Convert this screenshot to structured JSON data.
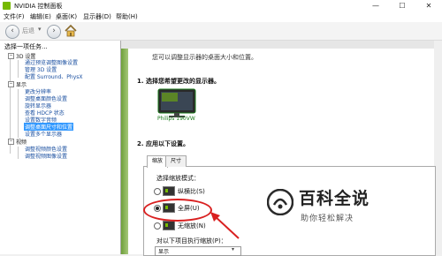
{
  "window": {
    "title": "NVIDIA 控制面板",
    "minimize": "—",
    "maximize": "☐",
    "close": "✕"
  },
  "menubar": {
    "items": [
      "文件(F)",
      "编辑(E)",
      "桌面(K)",
      "显示器(D)",
      "帮助(H)"
    ]
  },
  "toolbar": {
    "back_label": "后退",
    "back_icon": "arrow-left-icon",
    "forward_icon": "arrow-right-icon",
    "home_icon": "home-icon"
  },
  "left_pane": {
    "header": "选择一项任务...",
    "tree": [
      {
        "label": "3D 设置",
        "type": "category"
      },
      {
        "label": "通过预览调整图像设置",
        "type": "link"
      },
      {
        "label": "管理 3D 设置",
        "type": "link"
      },
      {
        "label": "配置 Surround、PhysX",
        "type": "link"
      },
      {
        "label": "显示",
        "type": "category"
      },
      {
        "label": "更改分辨率",
        "type": "link"
      },
      {
        "label": "调整桌面颜色设置",
        "type": "link"
      },
      {
        "label": "旋转显示器",
        "type": "link"
      },
      {
        "label": "查看 HDCP 状态",
        "type": "link"
      },
      {
        "label": "设置数字音频",
        "type": "link"
      },
      {
        "label": "调整桌面尺寸和位置",
        "type": "selected"
      },
      {
        "label": "设置多个显示器",
        "type": "link"
      },
      {
        "label": "视频",
        "type": "category"
      },
      {
        "label": "调整视频颜色设置",
        "type": "link"
      },
      {
        "label": "调整视频图像设置",
        "type": "link"
      }
    ]
  },
  "main": {
    "intro": "您可以调整显示器的桌面大小和位置。",
    "section1_title": "1. 选择您希望更改的显示器。",
    "monitor_label": "Philips 190VW",
    "section2_title": "2. 应用以下设置。",
    "tabs": [
      "缩放",
      "尺寸"
    ],
    "scaling_mode_label": "选择缩放模式：",
    "options": [
      {
        "label": "纵横比(S)",
        "selected": false
      },
      {
        "label": "全屏(U)",
        "selected": true
      },
      {
        "label": "无缩放(N)",
        "selected": false
      }
    ],
    "perform_scaling_label": "对以下项目执行缩放(P)：",
    "perform_scaling_value": "显示"
  },
  "watermark": {
    "title": "百科全说",
    "subtitle": "助你轻松解决"
  },
  "colors": {
    "nvidia_green": "#76b900",
    "annotation_red": "#d92020"
  }
}
